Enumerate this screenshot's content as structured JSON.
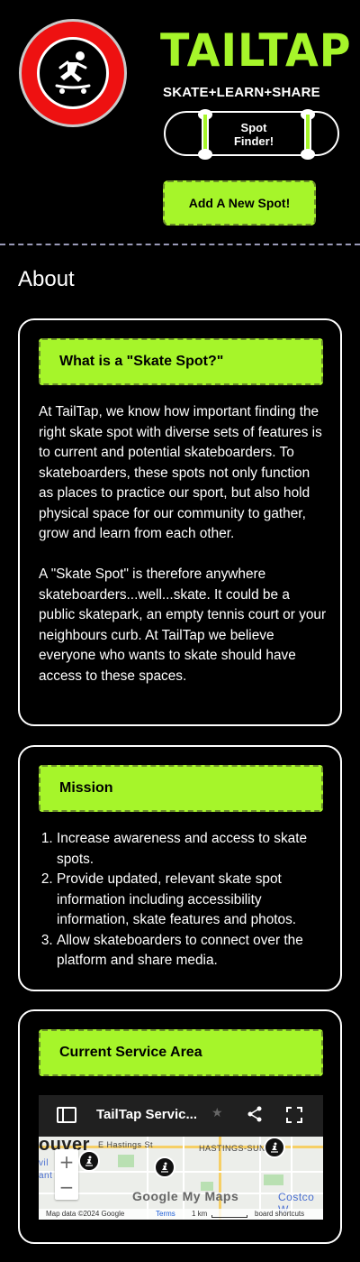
{
  "header": {
    "brand": "TAILTAP",
    "tagline": "SKATE+LEARN+SHARE",
    "spot_finder_label": "Spot Finder!",
    "add_spot_label": "Add A New Spot!",
    "logo_icon": "skateboarder-icon"
  },
  "about": {
    "title": "About",
    "skate_spot": {
      "heading": "What is a \"Skate Spot?\"",
      "paragraph_1": "At TailTap, we know how important finding the right skate spot with diverse sets of features is to current and potential skateboarders. To skateboarders, these spots not only function as places to practice our sport, but also hold physical space for our community to gather, grow and learn from each other.",
      "paragraph_2": "A \"Skate Spot\" is therefore anywhere skateboarders...well...skate. It could be a public skatepark, an empty tennis court or your neighbours curb. At TailTap we believe everyone who wants to skate should have access to these spaces."
    },
    "mission": {
      "heading": "Mission",
      "items": [
        "Increase awareness and access to skate spots.",
        "Provide updated, relevant skate spot information including accessibility information, skate features and photos.",
        "Allow skateboarders to connect over the platform and share media."
      ]
    },
    "service_area": {
      "heading": "Current Service Area",
      "map_title": "TailTap Servic...",
      "street_1": "E Hastings St",
      "street_2": "HASTINGS-SUN",
      "city_fragment": "ouver",
      "city_fragment_2": "vil",
      "city_fragment_3": "ant",
      "store": "Costco W",
      "google_label": "Google My Maps",
      "map_data": "Map data ©2024 Google",
      "terms": "Terms",
      "scale": "1 km",
      "shortcuts": "board shortcuts",
      "zoom_in": "+",
      "zoom_out": "−"
    }
  },
  "colors": {
    "accent": "#a6f52a",
    "logo_red": "#ee1111",
    "background": "#000000"
  }
}
